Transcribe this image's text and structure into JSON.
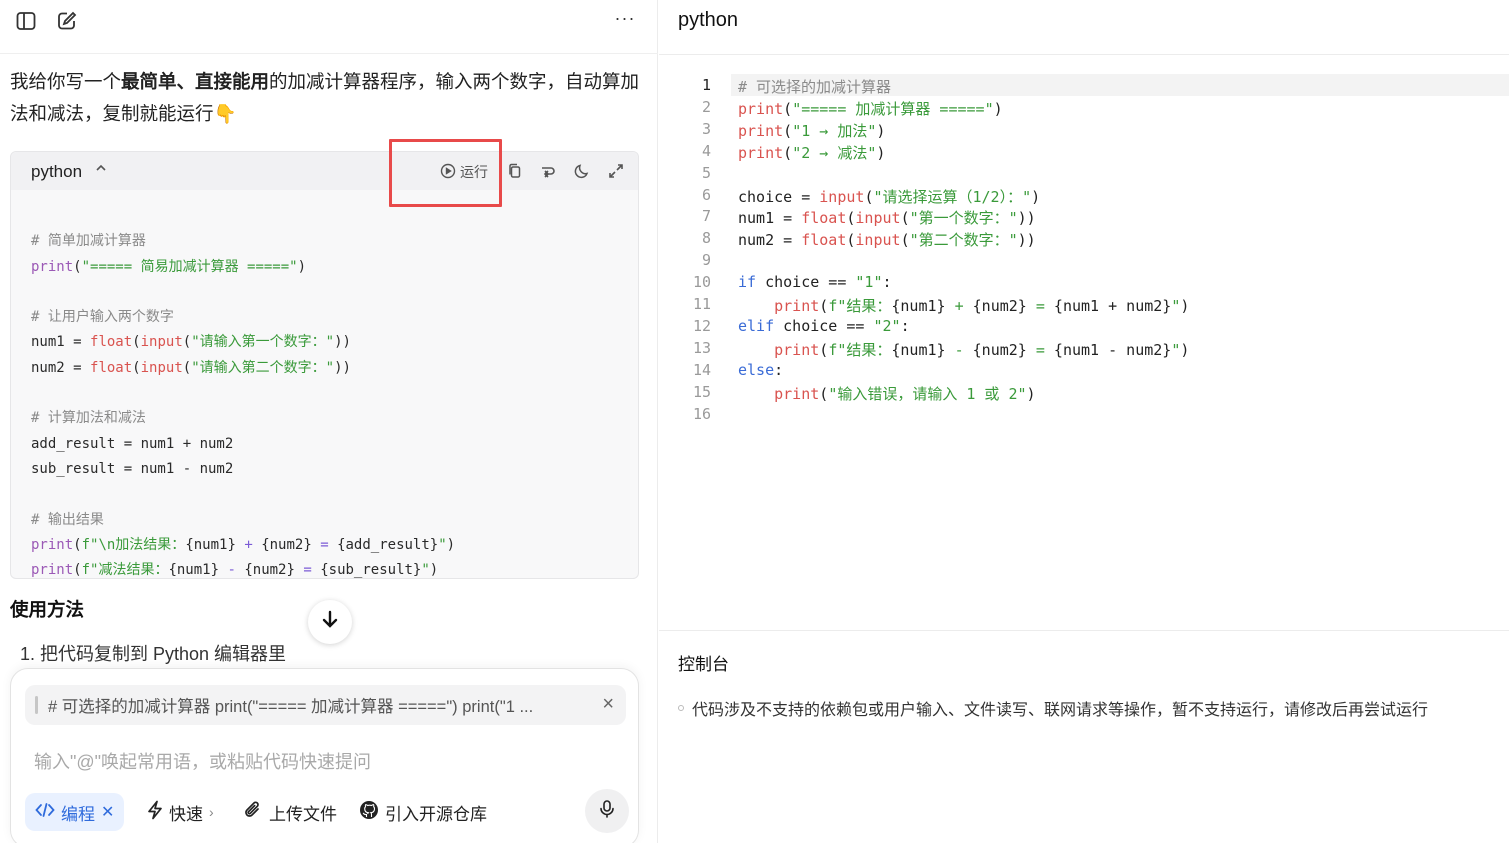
{
  "left": {
    "intro": {
      "part1": "我给你写一个",
      "bold": "最简单、直接能用",
      "part2": "的加减计算器程序，输入两个数字，自动算加法和减法，复制就能运行",
      "emoji": "👇"
    },
    "code_block": {
      "lang": "python",
      "run_label": "运行",
      "lines": [
        "# 简单加减计算器",
        "print(\"===== 简易加减计算器 =====\")",
        "",
        "# 让用户输入两个数字",
        "num1 = float(input(\"请输入第一个数字：\"))",
        "num2 = float(input(\"请输入第二个数字：\"))",
        "",
        "# 计算加法和减法",
        "add_result = num1 + num2",
        "sub_result = num1 - num2",
        "",
        "# 输出结果",
        "print(f\"\\n加法结果：{num1} + {num2} = {add_result}\")",
        "print(f\"减法结果：{num1} - {num2} = {sub_result}\")"
      ]
    },
    "usage_title": "使用方法",
    "usage_step1": "1. 把代码复制到 Python 编辑器里"
  },
  "input": {
    "quote_text": "# 可选择的加减计算器 print(\"===== 加减计算器 =====\") print(\"1 ...",
    "placeholder": "输入\"@\"唤起常用语，或粘贴代码快速提问",
    "mode_label": "编程",
    "tools": {
      "fast": "快速",
      "upload": "上传文件",
      "repo": "引入开源仓库"
    }
  },
  "right": {
    "title": "python",
    "editor_lines": [
      "# 可选择的加减计算器",
      "print(\"===== 加减计算器 =====\")",
      "print(\"1 → 加法\")",
      "print(\"2 → 减法\")",
      "",
      "choice = input(\"请选择运算（1/2）：\")",
      "num1 = float(input(\"第一个数字：\"))",
      "num2 = float(input(\"第二个数字：\"))",
      "",
      "if choice == \"1\":",
      "    print(f\"结果：{num1} + {num2} = {num1 + num2}\")",
      "elif choice == \"2\":",
      "    print(f\"结果：{num1} - {num2} = {num1 - num2}\")",
      "else:",
      "    print(\"输入错误，请输入 1 或 2\")",
      ""
    ],
    "console_title": "控制台",
    "console_msg": "代码涉及不支持的依赖包或用户输入、文件读写、联网请求等操作，暂不支持运行，请修改后再尝试运行"
  },
  "colors": {
    "highlight_box": "#e84a4a",
    "accent_blue": "#2f6bdc",
    "string_green": "#3a9a3a"
  }
}
